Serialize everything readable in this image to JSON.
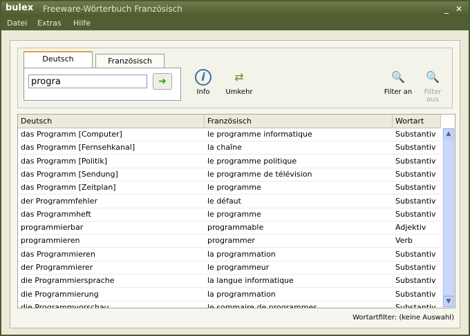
{
  "window": {
    "logo": "bulex",
    "title": "Freeware-Wörterbuch Französisch"
  },
  "menu": [
    "Datei",
    "Extras",
    "Hilfe"
  ],
  "tabs": [
    {
      "label": "Deutsch",
      "active": true
    },
    {
      "label": "Französisch",
      "active": false
    }
  ],
  "search": {
    "value": "progra"
  },
  "toolbar": {
    "info_label": "Info",
    "umkehr_label": "Umkehr",
    "filter_on_label": "Filter an",
    "filter_off_label": "Filter aus"
  },
  "table": {
    "columns": [
      "Deutsch",
      "Französisch",
      "Wortart"
    ],
    "rows": [
      [
        "das Programm [Computer]",
        "le programme informatique",
        "Substantiv"
      ],
      [
        "das Programm [Fernsehkanal]",
        "la chaîne",
        "Substantiv"
      ],
      [
        "das Programm [Politik]",
        "le programme politique",
        "Substantiv"
      ],
      [
        "das Programm [Sendung]",
        "le programme de télévision",
        "Substantiv"
      ],
      [
        "das Programm [Zeitplan]",
        "le programme",
        "Substantiv"
      ],
      [
        "der Programmfehler",
        "le défaut",
        "Substantiv"
      ],
      [
        "das Programmheft",
        "le programme",
        "Substantiv"
      ],
      [
        "programmierbar",
        "programmable",
        "Adjektiv"
      ],
      [
        "programmieren",
        "programmer",
        "Verb"
      ],
      [
        "das Programmieren",
        "la programmation",
        "Substantiv"
      ],
      [
        "der Programmierer",
        "le programmeur",
        "Substantiv"
      ],
      [
        "die Programmiersprache",
        "la langue informatique",
        "Substantiv"
      ],
      [
        "die Programmierung",
        "la programmation",
        "Substantiv"
      ],
      [
        "die Programmvorschau",
        "le sommaire de programmes",
        "Substantiv"
      ]
    ]
  },
  "status": "Wortartfilter: (keine Auswahl)"
}
